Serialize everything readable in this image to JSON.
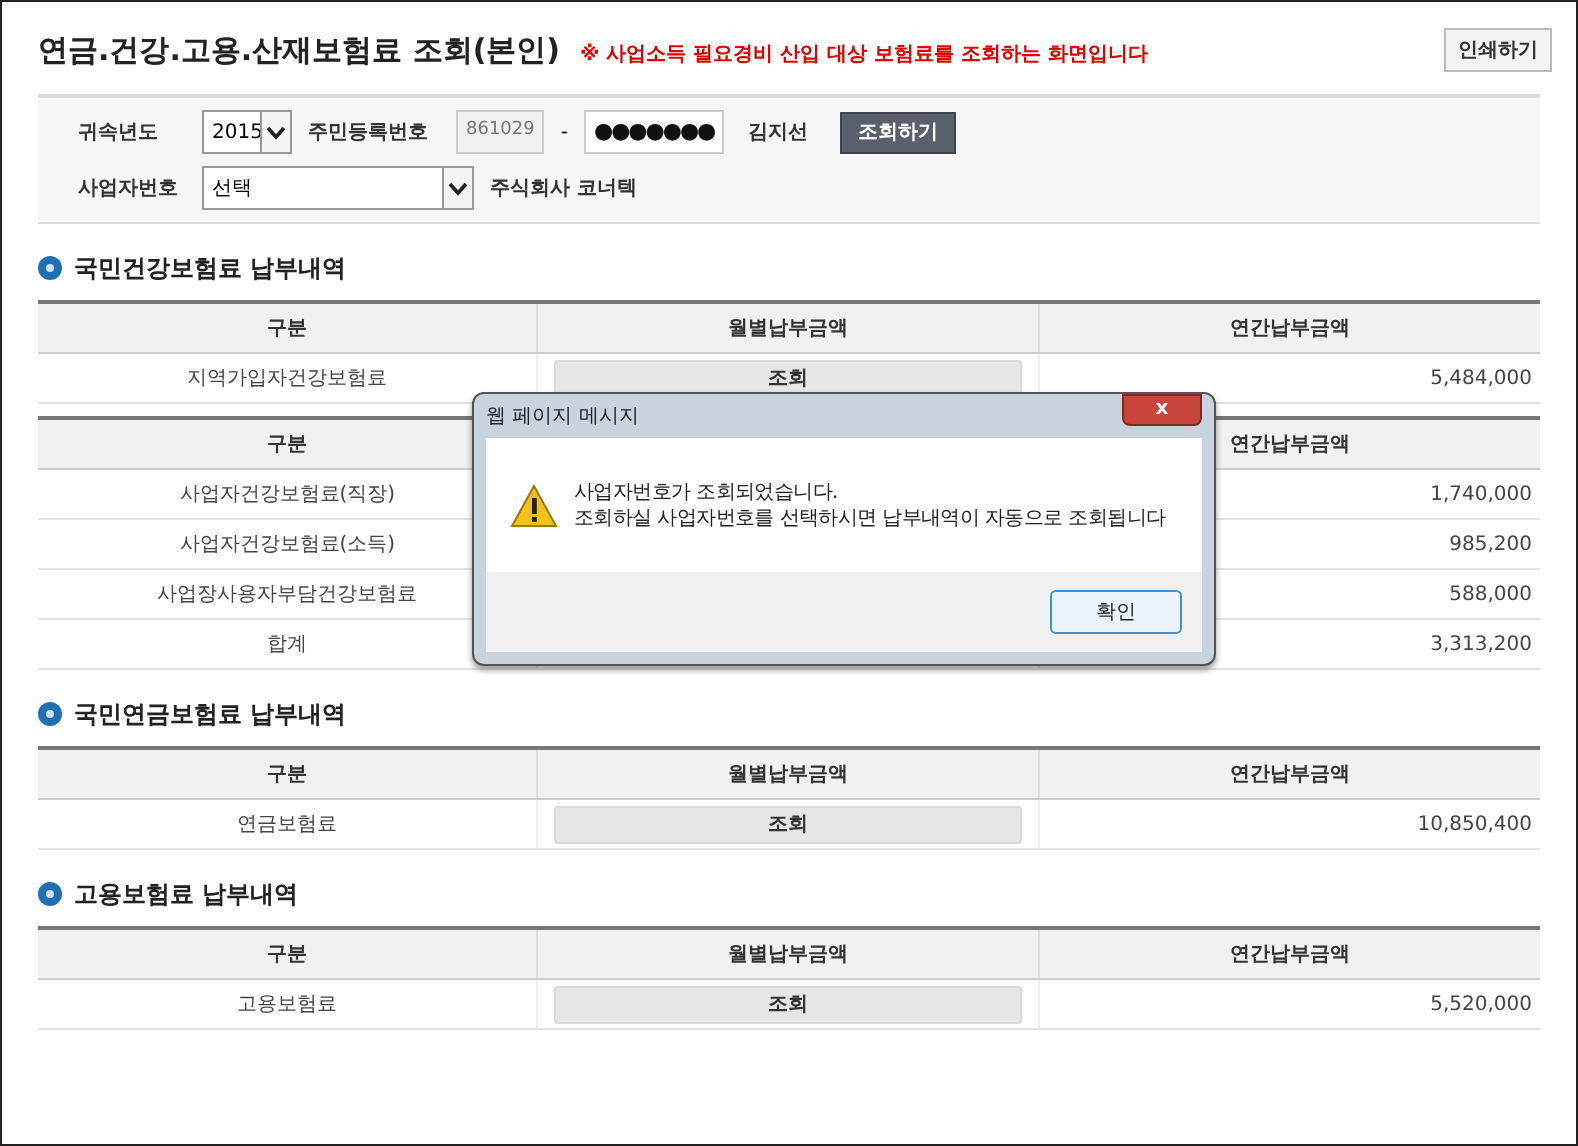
{
  "header": {
    "title": "연금.건강.고용.산재보험료 조회(본인)",
    "notice": "※ 사업소득 필요경비 산입 대상 보험료를 조회하는 화면입니다",
    "print_button": "인쇄하기"
  },
  "filters": {
    "year_label": "귀속년도",
    "year": "2015",
    "id_label": "주민등록번호",
    "id_front": "861029",
    "id_sep": "-",
    "id_back": "●●●●●●●",
    "name": "김지선",
    "search_button": "조회하기",
    "biz_label": "사업자번호",
    "biz_value": "선택",
    "company": "주식회사 코너텍"
  },
  "sections": [
    {
      "title": "국민건강보험료 납부내역",
      "tables": [
        {
          "columns": {
            "column_1": "구분",
            "column_2": "월별납부금액",
            "column_3": "연간납부금액"
          },
          "rows": [
            {
              "name": "지역가입자건강보험료",
              "monthly_button": "조회",
              "annual": "5,484,000"
            }
          ]
        },
        {
          "columns": {
            "column_1": "구분",
            "column_3": "연간납부금액"
          },
          "rows": [
            {
              "name": "사업자건강보험료(직장)",
              "annual": "1,740,000"
            },
            {
              "name": "사업자건강보험료(소득)",
              "annual": "985,200"
            },
            {
              "name": "사업장사용자부담건강보험료",
              "annual": "588,000"
            },
            {
              "name": "합계",
              "annual": "3,313,200"
            }
          ]
        }
      ]
    },
    {
      "title": "국민연금보험료 납부내역",
      "tables": [
        {
          "columns": {
            "column_1": "구분",
            "column_2": "월별납부금액",
            "column_3": "연간납부금액"
          },
          "rows": [
            {
              "name": "연금보험료",
              "monthly_button": "조회",
              "annual": "10,850,400"
            }
          ]
        }
      ]
    },
    {
      "title": "고용보험료 납부내역",
      "tables": [
        {
          "columns": {
            "column_1": "구분",
            "column_2": "월별납부금액",
            "column_3": "연간납부금액"
          },
          "rows": [
            {
              "name": "고용보험료",
              "monthly_button": "조회",
              "annual": "5,520,000"
            }
          ]
        }
      ]
    }
  ],
  "dialog": {
    "title": "웹 페이지 메시지",
    "close": "x",
    "lines": [
      "사업자번호가 조회되었습니다.",
      "조회하실 사업자번호를 선택하시면 납부내역이 자동으로 조회됩니다"
    ],
    "ok_button": "확인"
  }
}
